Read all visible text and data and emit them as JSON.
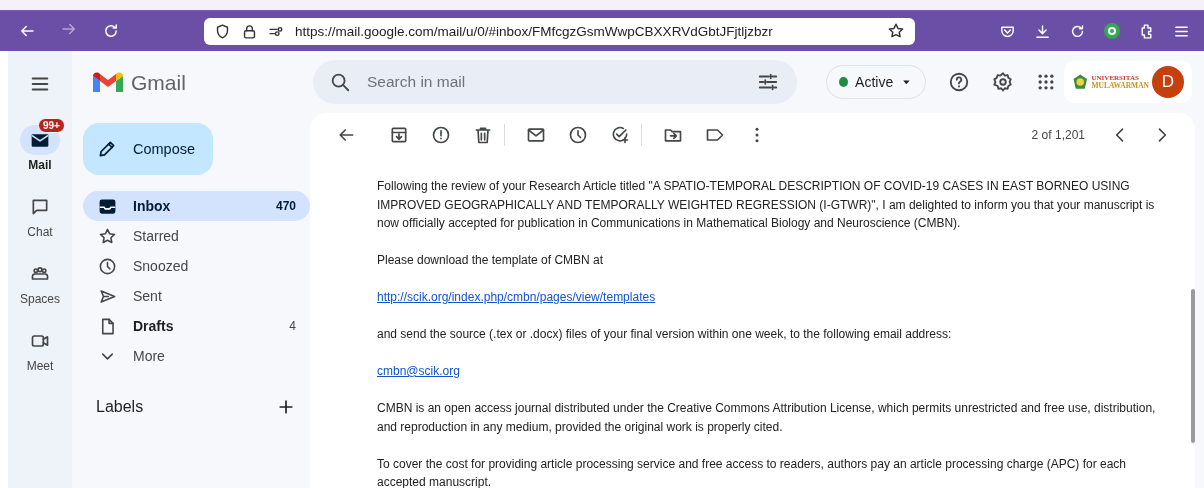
{
  "browser": {
    "url": "https://mail.google.com/mail/u/0/#inbox/FMfcgzGsmWwpCBXXRVdGbtJFjtljzbzr"
  },
  "rail": [
    {
      "kind": "mail",
      "label": "Mail",
      "selected": true,
      "badge": "99+"
    },
    {
      "kind": "chat",
      "label": "Chat",
      "selected": false
    },
    {
      "kind": "spaces",
      "label": "Spaces",
      "selected": false
    },
    {
      "kind": "meet",
      "label": "Meet",
      "selected": false
    }
  ],
  "brand": "Gmail",
  "compose": "Compose",
  "folders": [
    {
      "kind": "inbox",
      "label": "Inbox",
      "count": "470",
      "selected": true,
      "bold": true
    },
    {
      "kind": "starred",
      "label": "Starred",
      "selected": false,
      "bold": false
    },
    {
      "kind": "snoozed",
      "label": "Snoozed",
      "selected": false,
      "bold": false
    },
    {
      "kind": "sent",
      "label": "Sent",
      "selected": false,
      "bold": false
    },
    {
      "kind": "drafts",
      "label": "Drafts",
      "count": "4",
      "selected": false,
      "bold": true
    },
    {
      "kind": "more",
      "label": "More",
      "selected": false,
      "bold": false
    }
  ],
  "labels_heading": "Labels",
  "search": {
    "placeholder": "Search in mail"
  },
  "status": {
    "label": "Active",
    "color": "#1e8e3e"
  },
  "account": {
    "org_line1": "UNIVERSITAS",
    "org_line2": "MULAWARMAN",
    "avatar": "D"
  },
  "toolbar": {
    "position": "2 of 1,201"
  },
  "message": {
    "paragraphs": [
      {
        "kind": "text",
        "text": "Following the review of your Research Article titled \"A SPATIO-TEMPORAL DESCRIPTION OF COVID-19 CASES IN EAST BORNEO USING IMPROVED GEOGRAPHICALLY AND TEMPORALLY WEIGHTED REGRESSION (I-GTWR)\", I am delighted to inform you that your manuscript is now officially accepted for publication in Communications in Mathematical Biology and Neuroscience (CMBN)."
      },
      {
        "kind": "text",
        "text": "Please download the template of CMBN at"
      },
      {
        "kind": "link",
        "text": "http://scik.org/index.php/cmbn/pages/view/templates"
      },
      {
        "kind": "text",
        "text": "and send the source (.tex or .docx) files of your final version within one week, to the following email address:"
      },
      {
        "kind": "link",
        "text": "cmbn@scik.org"
      },
      {
        "kind": "text",
        "text": "CMBN is an open access journal distributed under the Creative Commons Attribution License, which permits unrestricted and free use, distribution, and reproduction in any medium, provided the original work is properly cited."
      },
      {
        "kind": "text",
        "text": "To cover the cost for providing article processing service and free access to readers, authors pay an article processing charge (APC) for each accepted manuscript."
      }
    ]
  }
}
